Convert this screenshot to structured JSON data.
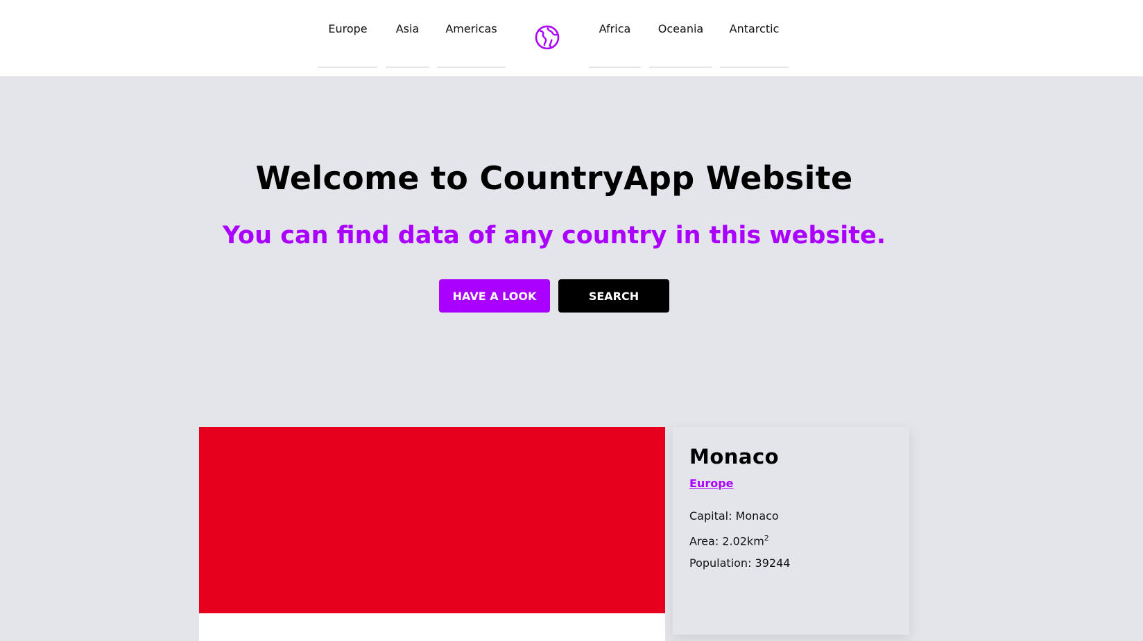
{
  "nav": {
    "left": [
      "Europe",
      "Asia",
      "Americas"
    ],
    "right": [
      "Africa",
      "Oceania",
      "Antarctic"
    ],
    "logo_icon": "globe-icon",
    "accent": "#aa00ff"
  },
  "hero": {
    "title": "Welcome to CountryApp Website",
    "subtitle": "You can find data of any country in this website.",
    "look_label": "HAVE A LOOK",
    "search_label": "SEARCH"
  },
  "country": {
    "name": "Monaco",
    "region": "Europe",
    "capital_label": "Capital: ",
    "capital": "Monaco",
    "area_label": "Area: ",
    "area": "2.02km",
    "area_unit_sup": "2",
    "population_label": "Population: ",
    "population": "39244",
    "flag_top_color": "#e6001e",
    "flag_bottom_color": "#ffffff"
  }
}
